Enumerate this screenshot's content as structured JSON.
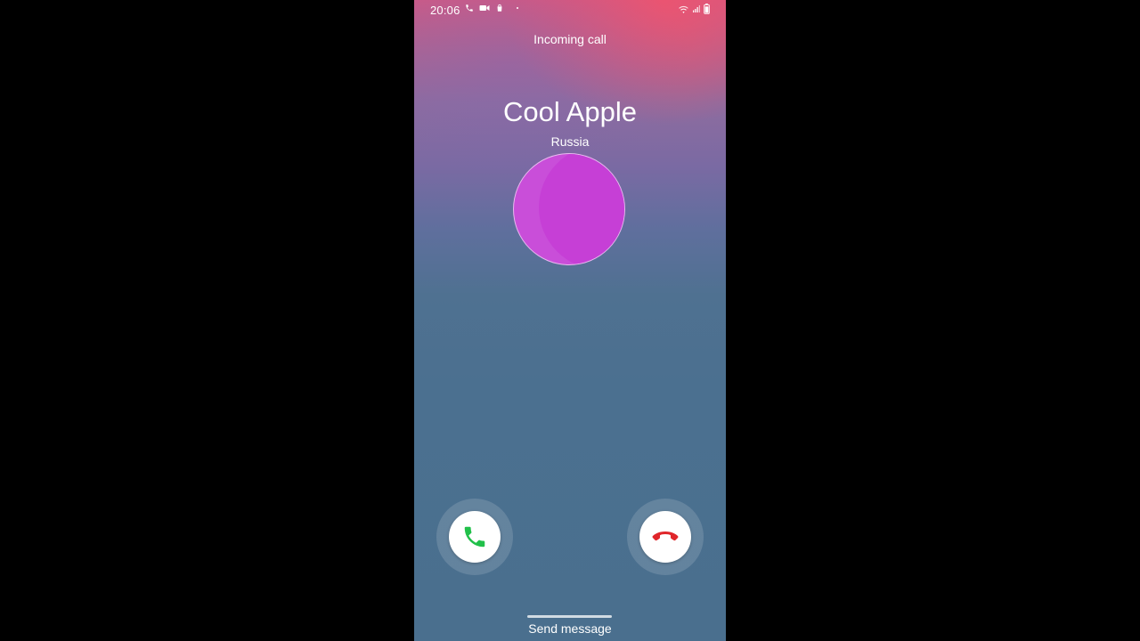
{
  "status_bar": {
    "time": "20:06",
    "left_icons": [
      "phone-icon",
      "video-call-icon",
      "shopping-bag-icon"
    ],
    "right_icons": [
      "wifi-icon",
      "signal-icon",
      "battery-icon"
    ]
  },
  "call": {
    "status_label": "Incoming call",
    "caller_name": "Cool Apple",
    "caller_location": "Russia",
    "avatar_color": "#c94ed9"
  },
  "actions": {
    "accept_icon": "phone-accept-icon",
    "accept_color": "#21c04a",
    "decline_icon": "phone-decline-icon",
    "decline_color": "#e0262b",
    "send_message_label": "Send message"
  }
}
